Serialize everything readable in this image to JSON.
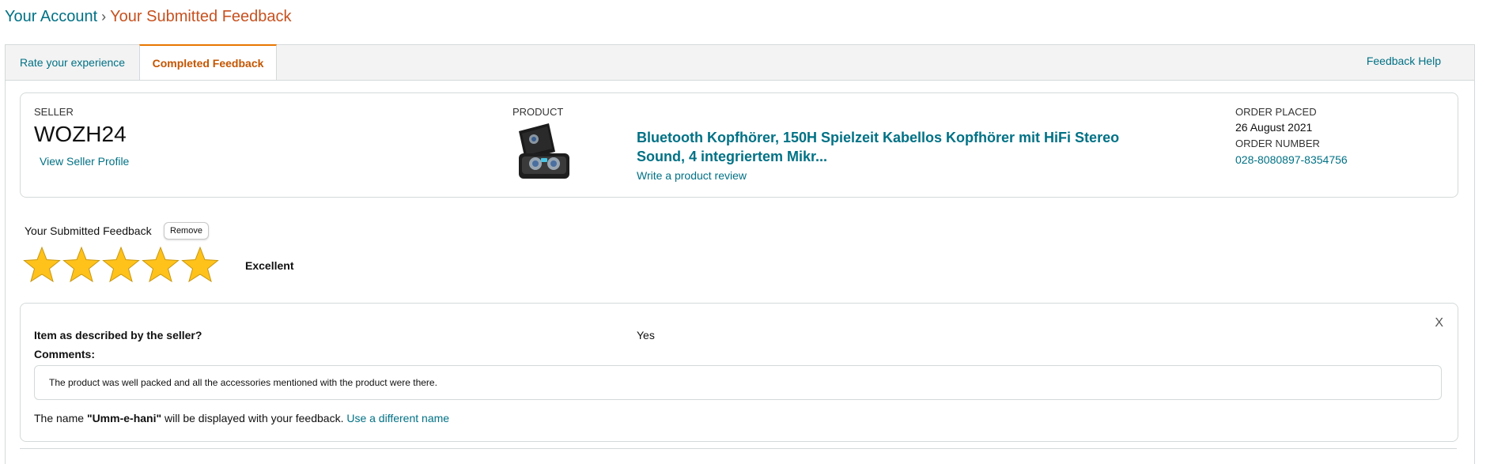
{
  "breadcrumb": {
    "account": "Your Account",
    "separator": "›",
    "current": "Your Submitted Feedback"
  },
  "tabs": {
    "rate": "Rate your experience",
    "completed": "Completed Feedback",
    "help": "Feedback Help"
  },
  "order_card": {
    "seller_label": "SELLER",
    "seller_name": "WOZH24",
    "seller_link": "View Seller Profile",
    "product_label": "PRODUCT",
    "product_title": "Bluetooth Kopfhörer, 150H Spielzeit Kabellos Kopfhörer mit HiFi Stereo Sound, 4 integriertem Mikr...",
    "review_link": "Write a product review",
    "order_placed_label": "ORDER PLACED",
    "order_placed_date": "26 August 2021",
    "order_number_label": "ORDER NUMBER",
    "order_number": "028-8080897-8354756"
  },
  "feedback": {
    "title": "Your Submitted Feedback",
    "remove_label": "Remove",
    "rating": 5,
    "rating_max": 5,
    "rating_text": "Excellent",
    "star_color": "#ffc21b"
  },
  "details": {
    "close": "X",
    "question": "Item as described by the seller?",
    "answer": "Yes",
    "comments_label": "Comments:",
    "comment": "The product was well packed and all the accessories mentioned with the product were there.",
    "name_prefix": "The name ",
    "name": "\"Umm-e-hani\"",
    "name_suffix": " will be displayed with your feedback. ",
    "name_link": "Use a different name"
  },
  "colors": {
    "link": "#007185",
    "accent_orange": "#c45500",
    "border": "#d5d9d9"
  }
}
